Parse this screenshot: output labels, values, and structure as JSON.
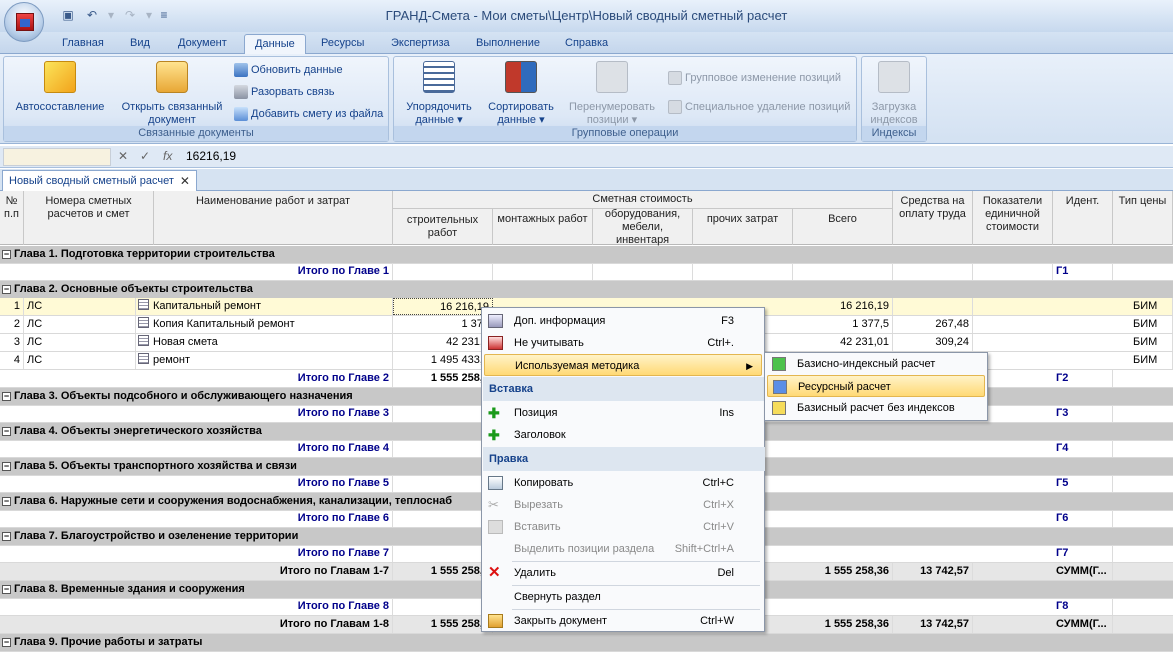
{
  "app": {
    "title": "ГРАНД-Смета - Мои сметы\\Центр\\Новый сводный сметный расчет",
    "qat_icons": [
      "save-icon",
      "undo-icon",
      "redo-icon",
      "customize-icon"
    ]
  },
  "ribbon_tabs": [
    "Главная",
    "Вид",
    "Документ",
    "Данные",
    "Ресурсы",
    "Экспертиза",
    "Выполнение",
    "Справка"
  ],
  "active_tab": "Данные",
  "ribbon": {
    "linked_docs": {
      "label": "Связанные документы",
      "auto": "Автосоставление",
      "open_linked_1": "Открыть связанный",
      "open_linked_2": "документ",
      "update": "Обновить данные",
      "break_link": "Разорвать связь",
      "add_from_file": "Добавить смету из файла"
    },
    "group_ops": {
      "label": "Групповые операции",
      "order_1": "Упорядочить",
      "order_2": "данные",
      "sort_1": "Сортировать",
      "sort_2": "данные",
      "renumber_1": "Перенумеровать",
      "renumber_2": "позиции",
      "group_change": "Групповое изменение позиций",
      "special_delete": "Специальное удаление позиций"
    },
    "indexes": {
      "label": "Индексы",
      "load_1": "Загрузка",
      "load_2": "индексов"
    }
  },
  "formula": {
    "name_box": "",
    "cancel_sym": "✕",
    "accept_sym": "✓",
    "fx_sym": "fx",
    "value": "16216,19"
  },
  "doc_tab": "Новый сводный сметный расчет",
  "headers": {
    "num": "№ п.п",
    "est_numbers": "Номера сметных расчетов и смет",
    "name": "Наименование работ и затрат",
    "cost": "Сметная стоимость",
    "build": "строительных работ",
    "mount": "монтажных работ",
    "equip": "оборудования, мебели, инвентаря",
    "other": "прочих затрат",
    "total": "Всего",
    "wage": "Средства на оплату труда",
    "unit": "Показатели единичной стоимости",
    "ident": "Идент.",
    "price_type": "Тип цены"
  },
  "rows": {
    "ch1": "Глава 1. Подготовка территории строительства",
    "t1": {
      "label": "Итого по Главе 1",
      "id": "Г1"
    },
    "ch2": "Глава 2. Основные объекты строительства",
    "r1": {
      "n": "1",
      "code": "ЛС",
      "name": "Капитальный ремонт",
      "build": "16 216,19",
      "total": "16 216,19",
      "wage": "",
      "price": "БИМ"
    },
    "r2": {
      "n": "2",
      "code": "ЛС",
      "name": "Копия Капитальный ремонт",
      "build": "1 377",
      "total": "1 377,5",
      "wage": "267,48",
      "price": "БИМ"
    },
    "r3": {
      "n": "3",
      "code": "ЛС",
      "name": "Новая смета",
      "build": "42 231,0",
      "total": "42 231,01",
      "wage": "309,24",
      "price": "БИМ"
    },
    "r4": {
      "n": "4",
      "code": "ЛС",
      "name": "ремонт",
      "build": "1 495 433,6",
      "total": "",
      "wage": "",
      "price": "БИМ"
    },
    "t2": {
      "label": "Итого по Главе 2",
      "build": "1 555 258,3",
      "id": "Г2"
    },
    "ch3": "Глава 3. Объекты подсобного и обслуживающего назначения",
    "t3": {
      "label": "Итого по Главе 3",
      "id": "Г3"
    },
    "ch4": "Глава 4. Объекты энергетического хозяйства",
    "t4": {
      "label": "Итого по Главе 4",
      "id": "Г4"
    },
    "ch5": "Глава 5. Объекты транспортного хозяйства и связи",
    "t5": {
      "label": "Итого по Главе 5",
      "id": "Г5"
    },
    "ch6": "Глава 6. Наружные сети и сооружения водоснабжения, канализации, теплоснаб",
    "t6": {
      "label": "Итого по Главе 6",
      "id": "Г6"
    },
    "ch7": "Глава 7. Благоустройство и озеленение территории",
    "t7": {
      "label": "Итого по Главе 7",
      "id": "Г7"
    },
    "s17": {
      "label": "Итого по Главам 1-7",
      "build": "1 555 258,3",
      "total": "1 555 258,36",
      "wage": "13 742,57",
      "id": "СУММ(Г..."
    },
    "ch8": "Глава 8. Временные здания и сооружения",
    "t8": {
      "label": "Итого по Главе 8",
      "id": "Г8"
    },
    "s18": {
      "label": "Итого по Главам 1-8",
      "build": "1 555 258,3",
      "total": "1 555 258,36",
      "wage": "13 742,57",
      "id": "СУММ(Г..."
    },
    "ch9": "Глава 9. Прочие работы и затраты"
  },
  "context_menu": {
    "extra_info": "Доп. информация",
    "extra_info_sc": "F3",
    "ignore": "Не учитывать",
    "ignore_sc": "Ctrl+.",
    "method": "Используемая методика",
    "insert_section": "Вставка",
    "position": "Позиция",
    "position_sc": "Ins",
    "heading": "Заголовок",
    "edit_section": "Правка",
    "copy": "Копировать",
    "copy_sc": "Ctrl+C",
    "cut": "Вырезать",
    "cut_sc": "Ctrl+X",
    "paste": "Вставить",
    "paste_sc": "Ctrl+V",
    "select_section": "Выделить позиции раздела",
    "select_section_sc": "Shift+Ctrl+A",
    "delete": "Удалить",
    "delete_sc": "Del",
    "collapse": "Свернуть раздел",
    "close_doc": "Закрыть документ",
    "close_doc_sc": "Ctrl+W"
  },
  "submenu": {
    "basis_index": "Базисно-индексный расчет",
    "resource": "Ресурсный расчет",
    "basis_no_index": "Базисный расчет без индексов"
  },
  "colors": {
    "ribbon_text": "#15428b",
    "chapter_bg": "#c8c8c8",
    "selected_row": "#fffad6",
    "menu_highlight": "#ffd975"
  }
}
